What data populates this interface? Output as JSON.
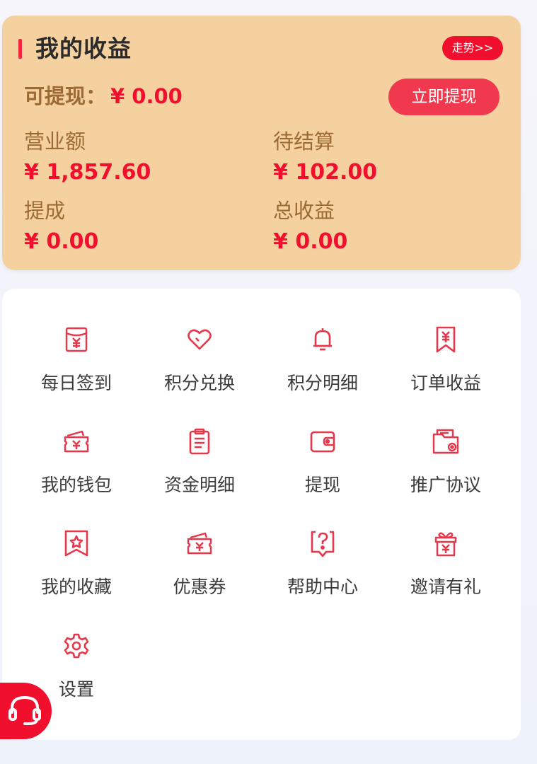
{
  "earnings": {
    "title": "我的收益",
    "trend_label": "走势>>",
    "withdrawable_label": "可提现：",
    "withdrawable_value": "¥ 0.00",
    "withdraw_button": "立即提现",
    "stats": [
      {
        "label": "营业额",
        "value": "¥ 1,857.60"
      },
      {
        "label": "待结算",
        "value": "¥ 102.00"
      },
      {
        "label": "提成",
        "value": "¥ 0.00"
      },
      {
        "label": "总收益",
        "value": "¥ 0.00"
      }
    ]
  },
  "menu": {
    "items": [
      {
        "label": "每日签到",
        "icon": "checkin-envelope-icon"
      },
      {
        "label": "积分兑换",
        "icon": "heart-icon"
      },
      {
        "label": "积分明细",
        "icon": "bell-icon"
      },
      {
        "label": "订单收益",
        "icon": "yen-ribbon-icon"
      },
      {
        "label": "我的钱包",
        "icon": "wallet-ticket-icon"
      },
      {
        "label": "资金明细",
        "icon": "clipboard-icon"
      },
      {
        "label": "提现",
        "icon": "wallet-icon"
      },
      {
        "label": "推广协议",
        "icon": "folder-document-icon"
      },
      {
        "label": "我的收藏",
        "icon": "star-bookmark-icon"
      },
      {
        "label": "优惠券",
        "icon": "coupon-icon"
      },
      {
        "label": "帮助中心",
        "icon": "help-bubble-icon"
      },
      {
        "label": "邀请有礼",
        "icon": "gift-icon"
      },
      {
        "label": "设置",
        "icon": "gear-icon"
      }
    ]
  },
  "customer_service": {
    "icon": "headset-icon"
  },
  "colors": {
    "accent": "#f0102e",
    "card_bg": "#f6d1a0",
    "label_brown": "#9b6a35",
    "icon_red": "#e8364a"
  }
}
